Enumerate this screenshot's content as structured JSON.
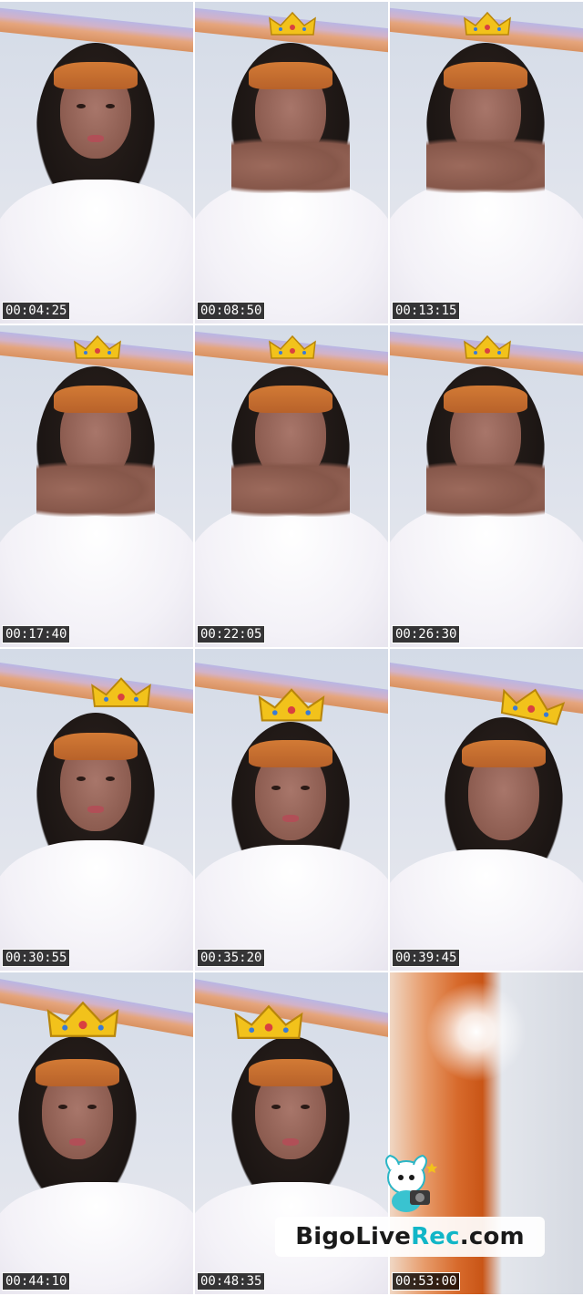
{
  "timestamps": [
    "00:04:25",
    "00:08:50",
    "00:13:15",
    "00:17:40",
    "00:22:05",
    "00:26:30",
    "00:30:55",
    "00:35:20",
    "00:39:45",
    "00:44:10",
    "00:48:35",
    "00:53:00"
  ],
  "watermark": {
    "prefix": "BigoLive",
    "accent": "Rec",
    "suffix": ".com"
  },
  "colors": {
    "timestamp_bg": "#000000",
    "watermark_accent": "#12b6c7",
    "headband": "#c96a2c",
    "crown": "#f2c21b"
  },
  "icons": [
    "crown-icon",
    "bigo-mascot-icon"
  ]
}
